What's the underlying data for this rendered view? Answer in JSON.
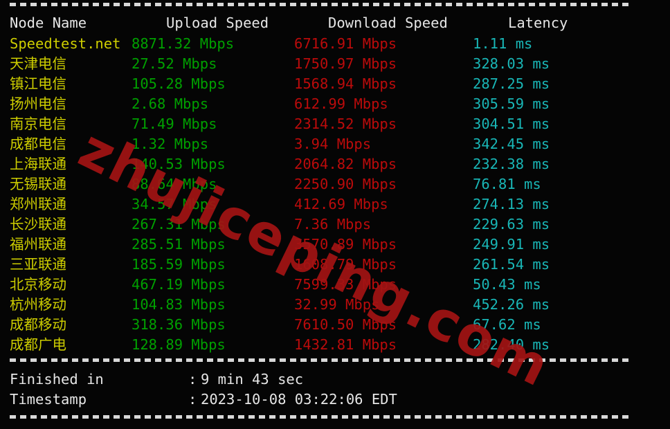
{
  "terminal": {
    "separator_char": "-",
    "watermark_text": "zhujiceping.com",
    "colors": {
      "background": "#050505",
      "node_name": "#cdcd00",
      "upload": "#00a000",
      "download": "#bb0b0b",
      "latency": "#19b6b6",
      "header": "#e6e6e6",
      "separator": "#d8d8d8",
      "watermark": "#a31414"
    }
  },
  "table": {
    "headers": {
      "node": "Node Name",
      "upload": "Upload Speed",
      "download": "Download Speed",
      "latency": "Latency"
    },
    "rows": [
      {
        "node": "Speedtest.net",
        "upload": "8871.32 Mbps",
        "download": "6716.91 Mbps",
        "latency": "1.11 ms"
      },
      {
        "node": "天津电信",
        "upload": "27.52 Mbps",
        "download": "1750.97 Mbps",
        "latency": "328.03 ms"
      },
      {
        "node": "镇江电信",
        "upload": "105.28 Mbps",
        "download": "1568.94 Mbps",
        "latency": "287.25 ms"
      },
      {
        "node": "扬州电信",
        "upload": "2.68 Mbps",
        "download": "612.99 Mbps",
        "latency": "305.59 ms"
      },
      {
        "node": "南京电信",
        "upload": "71.49 Mbps",
        "download": "2314.52 Mbps",
        "latency": "304.51 ms"
      },
      {
        "node": "成都电信",
        "upload": "1.32 Mbps",
        "download": "3.94 Mbps",
        "latency": "342.45 ms"
      },
      {
        "node": "上海联通",
        "upload": "140.53 Mbps",
        "download": "2064.82 Mbps",
        "latency": "232.38 ms"
      },
      {
        "node": "无锡联通",
        "upload": "88.64 Mbps",
        "download": "2250.90 Mbps",
        "latency": "76.81 ms"
      },
      {
        "node": "郑州联通",
        "upload": "34.57 Mbps",
        "download": "412.69 Mbps",
        "latency": "274.13 ms"
      },
      {
        "node": "长沙联通",
        "upload": "267.31 Mbps",
        "download": "7.36 Mbps",
        "latency": "229.63 ms"
      },
      {
        "node": "福州联通",
        "upload": "285.51 Mbps",
        "download": "3570.89 Mbps",
        "latency": "249.91 ms"
      },
      {
        "node": "三亚联通",
        "upload": "185.59 Mbps",
        "download": "1608.79 Mbps",
        "latency": "261.54 ms"
      },
      {
        "node": "北京移动",
        "upload": "467.19 Mbps",
        "download": "7599.33 Mbps",
        "latency": "50.43 ms"
      },
      {
        "node": "杭州移动",
        "upload": "104.83 Mbps",
        "download": "32.99 Mbps",
        "latency": "452.26 ms"
      },
      {
        "node": "成都移动",
        "upload": "318.36 Mbps",
        "download": "7610.50 Mbps",
        "latency": "67.62 ms"
      },
      {
        "node": "成都广电",
        "upload": "128.89 Mbps",
        "download": "1432.81 Mbps",
        "latency": "282.40 ms"
      }
    ]
  },
  "summary": {
    "colon": ":",
    "items": [
      {
        "label": "Finished in",
        "value": "9 min 43 sec"
      },
      {
        "label": "Timestamp",
        "value": "2023-10-08 03:22:06 EDT"
      }
    ]
  }
}
